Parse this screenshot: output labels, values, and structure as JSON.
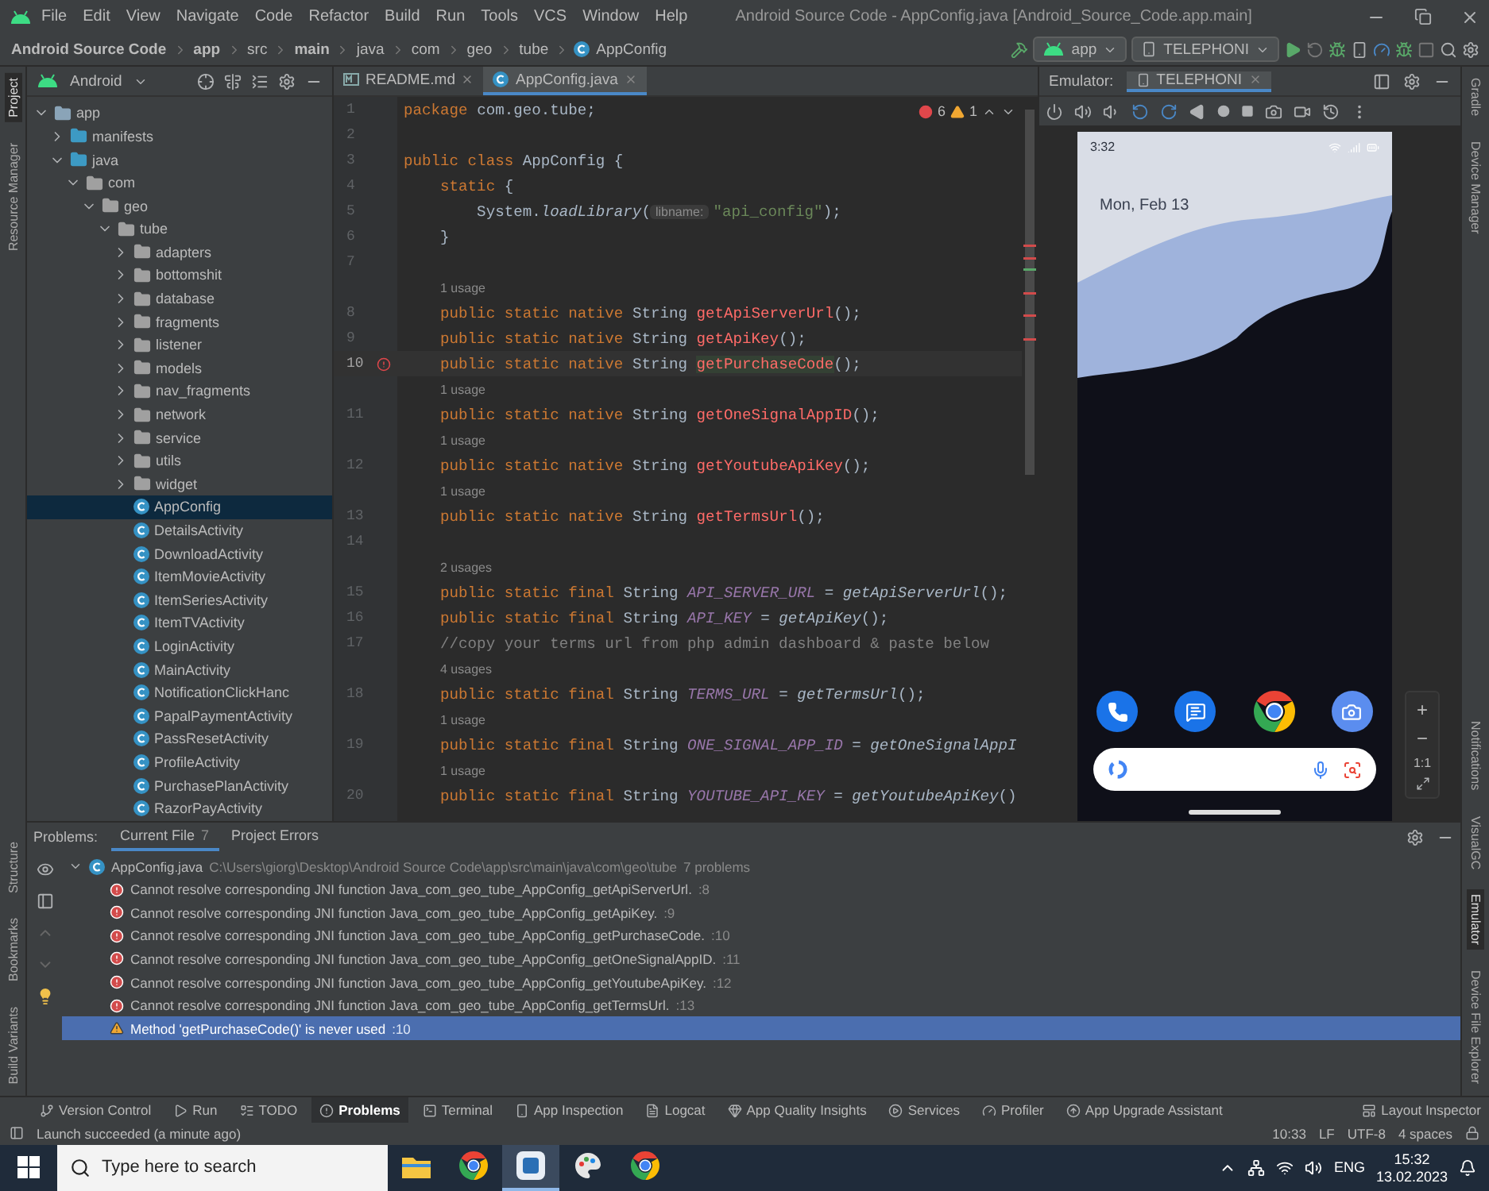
{
  "menu": [
    "File",
    "Edit",
    "View",
    "Navigate",
    "Code",
    "Refactor",
    "Build",
    "Run",
    "Tools",
    "VCS",
    "Window",
    "Help"
  ],
  "window_title": "Android Source Code - AppConfig.java [Android_Source_Code.app.main]",
  "breadcrumbs": [
    {
      "label": "Android Source Code",
      "bold": true
    },
    {
      "label": "app",
      "bold": true
    },
    {
      "label": "src",
      "bold": false
    },
    {
      "label": "main",
      "bold": true
    },
    {
      "label": "java",
      "bold": false
    },
    {
      "label": "com",
      "bold": false
    },
    {
      "label": "geo",
      "bold": false
    },
    {
      "label": "tube",
      "bold": false
    },
    {
      "label": "AppConfig",
      "bold": false
    }
  ],
  "run_config": "app",
  "device": "TELEPHONI",
  "left_strip": {
    "top": [
      {
        "label": "Project",
        "selected": true
      },
      {
        "label": "Resource Manager",
        "selected": false
      }
    ],
    "bottom": [
      {
        "label": "Structure",
        "selected": false
      },
      {
        "label": "Bookmarks",
        "selected": false
      },
      {
        "label": "Build Variants",
        "selected": false
      }
    ]
  },
  "right_strip": {
    "top": [
      {
        "label": "Gradle",
        "selected": false
      },
      {
        "label": "Device Manager",
        "selected": false
      }
    ],
    "bottom": [
      {
        "label": "Notifications",
        "selected": false
      },
      {
        "label": "VisualGC",
        "selected": false
      },
      {
        "label": "Emulator",
        "selected": true
      },
      {
        "label": "Device File Explorer",
        "selected": false
      }
    ]
  },
  "project": {
    "view": "Android",
    "tree": [
      {
        "label": "app",
        "kind": "module",
        "expanded": true,
        "selected": false,
        "children": [
          {
            "label": "manifests",
            "kind": "folder",
            "expanded": false,
            "selected": false
          },
          {
            "label": "java",
            "kind": "folder",
            "expanded": true,
            "selected": false,
            "children": [
              {
                "label": "com",
                "kind": "package",
                "expanded": true,
                "selected": false,
                "children": [
                  {
                    "label": "geo",
                    "kind": "package",
                    "expanded": true,
                    "selected": false,
                    "children": [
                      {
                        "label": "tube",
                        "kind": "package",
                        "expanded": true,
                        "selected": false,
                        "children": [
                          {
                            "label": "adapters",
                            "kind": "package",
                            "expanded": false,
                            "selected": false
                          },
                          {
                            "label": "bottomshit",
                            "kind": "package",
                            "expanded": false,
                            "selected": false
                          },
                          {
                            "label": "database",
                            "kind": "package",
                            "expanded": false,
                            "selected": false
                          },
                          {
                            "label": "fragments",
                            "kind": "package",
                            "expanded": false,
                            "selected": false
                          },
                          {
                            "label": "listener",
                            "kind": "package",
                            "expanded": false,
                            "selected": false
                          },
                          {
                            "label": "models",
                            "kind": "package",
                            "expanded": false,
                            "selected": false
                          },
                          {
                            "label": "nav_fragments",
                            "kind": "package",
                            "expanded": false,
                            "selected": false
                          },
                          {
                            "label": "network",
                            "kind": "package",
                            "expanded": false,
                            "selected": false
                          },
                          {
                            "label": "service",
                            "kind": "package",
                            "expanded": false,
                            "selected": false
                          },
                          {
                            "label": "utils",
                            "kind": "package",
                            "expanded": false,
                            "selected": false
                          },
                          {
                            "label": "widget",
                            "kind": "package",
                            "expanded": false,
                            "selected": false
                          },
                          {
                            "label": "AppConfig",
                            "kind": "class",
                            "selected": true
                          },
                          {
                            "label": "DetailsActivity",
                            "kind": "class",
                            "selected": false
                          },
                          {
                            "label": "DownloadActivity",
                            "kind": "class",
                            "selected": false
                          },
                          {
                            "label": "ItemMovieActivity",
                            "kind": "class",
                            "selected": false
                          },
                          {
                            "label": "ItemSeriesActivity",
                            "kind": "class",
                            "selected": false
                          },
                          {
                            "label": "ItemTVActivity",
                            "kind": "class",
                            "selected": false
                          },
                          {
                            "label": "LoginActivity",
                            "kind": "class",
                            "selected": false
                          },
                          {
                            "label": "MainActivity",
                            "kind": "class",
                            "selected": false
                          },
                          {
                            "label": "NotificationClickHanc",
                            "kind": "class",
                            "selected": false
                          },
                          {
                            "label": "PapalPaymentActivity",
                            "kind": "class",
                            "selected": false
                          },
                          {
                            "label": "PassResetActivity",
                            "kind": "class",
                            "selected": false
                          },
                          {
                            "label": "ProfileActivity",
                            "kind": "class",
                            "selected": false
                          },
                          {
                            "label": "PurchasePlanActivity",
                            "kind": "class",
                            "selected": false
                          },
                          {
                            "label": "RazorPayActivity",
                            "kind": "class",
                            "selected": false
                          }
                        ]
                      }
                    ]
                  }
                ]
              }
            ]
          }
        ]
      }
    ]
  },
  "editor": {
    "tabs": [
      {
        "label": "README.md",
        "kind": "markdown",
        "selected": false
      },
      {
        "label": "AppConfig.java",
        "kind": "class",
        "selected": true
      }
    ],
    "errors": "6",
    "warnings": "1",
    "lines": [
      {
        "number": "1",
        "current": false,
        "error_mark": false,
        "tokens": [
          {
            "kind": "kw",
            "text": "package "
          },
          {
            "kind": "plain",
            "text": "com.geo.tube;"
          }
        ]
      },
      {
        "number": "2",
        "current": false,
        "error_mark": false
      },
      {
        "number": "3",
        "current": false,
        "error_mark": false,
        "tokens": [
          {
            "kind": "kw",
            "text": "public class "
          },
          {
            "kind": "plain",
            "text": "AppConfig {"
          }
        ]
      },
      {
        "number": "4",
        "current": false,
        "error_mark": false,
        "tokens": [
          {
            "kind": "kw",
            "text": "    static "
          },
          {
            "kind": "plain",
            "text": "{"
          }
        ]
      },
      {
        "number": "5",
        "current": false,
        "error_mark": false,
        "tokens": [
          {
            "kind": "plain",
            "text": "        System."
          },
          {
            "kind": "call",
            "text": "loadLibrary"
          },
          {
            "kind": "plain",
            "text": "("
          },
          {
            "kind": "param",
            "text": "libname:"
          },
          {
            "kind": "str",
            "text": "\"api_config\""
          },
          {
            "kind": "plain",
            "text": ");"
          }
        ]
      },
      {
        "number": "6",
        "current": false,
        "error_mark": false,
        "tokens": [
          {
            "kind": "plain",
            "text": "    }"
          }
        ]
      },
      {
        "number": "7",
        "current": false,
        "error_mark": false
      },
      {
        "number": "8",
        "usage": "1 usage",
        "current": false,
        "error_mark": false,
        "tokens": [
          {
            "kind": "kw",
            "text": "    public static native "
          },
          {
            "kind": "plain",
            "text": "String "
          },
          {
            "kind": "native",
            "text": "getApiServerUrl"
          },
          {
            "kind": "plain",
            "text": "();"
          }
        ]
      },
      {
        "number": "9",
        "current": false,
        "error_mark": false,
        "tokens": [
          {
            "kind": "kw",
            "text": "    public static native "
          },
          {
            "kind": "plain",
            "text": "String "
          },
          {
            "kind": "native",
            "text": "getApiKey"
          },
          {
            "kind": "plain",
            "text": "();"
          }
        ]
      },
      {
        "number": "10",
        "current": true,
        "error_mark": true,
        "tokens": [
          {
            "kind": "kw",
            "text": "    public static native "
          },
          {
            "kind": "plain",
            "text": "String "
          },
          {
            "kind": "unused",
            "text": "getPurchaseCode"
          },
          {
            "kind": "plain",
            "text": "();"
          }
        ]
      },
      {
        "number": "11",
        "usage": "1 usage",
        "current": false,
        "error_mark": false,
        "tokens": [
          {
            "kind": "kw",
            "text": "    public static native "
          },
          {
            "kind": "plain",
            "text": "String "
          },
          {
            "kind": "native",
            "text": "getOneSignalAppID"
          },
          {
            "kind": "plain",
            "text": "();"
          }
        ]
      },
      {
        "number": "12",
        "usage": "1 usage",
        "current": false,
        "error_mark": false,
        "tokens": [
          {
            "kind": "kw",
            "text": "    public static native "
          },
          {
            "kind": "plain",
            "text": "String "
          },
          {
            "kind": "native",
            "text": "getYoutubeApiKey"
          },
          {
            "kind": "plain",
            "text": "();"
          }
        ]
      },
      {
        "number": "13",
        "usage": "1 usage",
        "current": false,
        "error_mark": false,
        "tokens": [
          {
            "kind": "kw",
            "text": "    public static native "
          },
          {
            "kind": "plain",
            "text": "String "
          },
          {
            "kind": "native",
            "text": "getTermsUrl"
          },
          {
            "kind": "plain",
            "text": "();"
          }
        ]
      },
      {
        "number": "14",
        "current": false,
        "error_mark": false
      },
      {
        "number": "15",
        "usage": "2 usages",
        "current": false,
        "error_mark": false,
        "tokens": [
          {
            "kind": "kw",
            "text": "    public static final "
          },
          {
            "kind": "plain",
            "text": "String "
          },
          {
            "kind": "const",
            "text": "API_SERVER_URL"
          },
          {
            "kind": "plain",
            "text": " = "
          },
          {
            "kind": "call",
            "text": "getApiServerUrl"
          },
          {
            "kind": "plain",
            "text": "();"
          }
        ]
      },
      {
        "number": "16",
        "current": false,
        "error_mark": false,
        "tokens": [
          {
            "kind": "kw",
            "text": "    public static final "
          },
          {
            "kind": "plain",
            "text": "String "
          },
          {
            "kind": "const",
            "text": "API_KEY"
          },
          {
            "kind": "plain",
            "text": " = "
          },
          {
            "kind": "call",
            "text": "getApiKey"
          },
          {
            "kind": "plain",
            "text": "();"
          }
        ]
      },
      {
        "number": "17",
        "current": false,
        "error_mark": false,
        "tokens": [
          {
            "kind": "comment",
            "text": "    //copy your terms url from php admin dashboard & paste below"
          }
        ]
      },
      {
        "number": "18",
        "usage": "4 usages",
        "current": false,
        "error_mark": false,
        "tokens": [
          {
            "kind": "kw",
            "text": "    public static final "
          },
          {
            "kind": "plain",
            "text": "String "
          },
          {
            "kind": "const",
            "text": "TERMS_URL"
          },
          {
            "kind": "plain",
            "text": " = "
          },
          {
            "kind": "call",
            "text": "getTermsUrl"
          },
          {
            "kind": "plain",
            "text": "();"
          }
        ]
      },
      {
        "number": "19",
        "usage": "1 usage",
        "current": false,
        "error_mark": false,
        "tokens": [
          {
            "kind": "kw",
            "text": "    public static final "
          },
          {
            "kind": "plain",
            "text": "String "
          },
          {
            "kind": "const",
            "text": "ONE_SIGNAL_APP_ID"
          },
          {
            "kind": "plain",
            "text": " = "
          },
          {
            "kind": "call",
            "text": "getOneSignalAppI"
          }
        ]
      },
      {
        "number": "20",
        "usage": "1 usage",
        "current": false,
        "error_mark": false,
        "tokens": [
          {
            "kind": "kw",
            "text": "    public static final "
          },
          {
            "kind": "plain",
            "text": "String "
          },
          {
            "kind": "const",
            "text": "YOUTUBE_API_KEY"
          },
          {
            "kind": "plain",
            "text": " = "
          },
          {
            "kind": "call",
            "text": "getYoutubeApiKey"
          },
          {
            "kind": "plain",
            "text": "()"
          }
        ]
      }
    ]
  },
  "emulator": {
    "label": "Emulator:",
    "tab": "TELEPHONI",
    "phone": {
      "time": "3:32",
      "date": "Mon, Feb 13"
    },
    "zoom": [
      "+",
      "−",
      "1:1"
    ]
  },
  "problems": {
    "label": "Problems:",
    "tabs": [
      {
        "label": "Current File",
        "count": "7",
        "selected": true
      },
      {
        "label": "Project Errors",
        "selected": false
      }
    ],
    "file": {
      "name": "AppConfig.java",
      "path": "C:\\Users\\giorg\\Desktop\\Android Source Code\\app\\src\\main\\java\\com\\geo\\tube",
      "count": "7 problems"
    },
    "items": [
      {
        "kind": "error",
        "text": "Cannot resolve corresponding JNI function Java_com_geo_tube_AppConfig_getApiServerUrl.",
        "line": ":8",
        "selected": false
      },
      {
        "kind": "error",
        "text": "Cannot resolve corresponding JNI function Java_com_geo_tube_AppConfig_getApiKey.",
        "line": ":9",
        "selected": false
      },
      {
        "kind": "error",
        "text": "Cannot resolve corresponding JNI function Java_com_geo_tube_AppConfig_getPurchaseCode.",
        "line": ":10",
        "selected": false
      },
      {
        "kind": "error",
        "text": "Cannot resolve corresponding JNI function Java_com_geo_tube_AppConfig_getOneSignalAppID.",
        "line": ":11",
        "selected": false
      },
      {
        "kind": "error",
        "text": "Cannot resolve corresponding JNI function Java_com_geo_tube_AppConfig_getYoutubeApiKey.",
        "line": ":12",
        "selected": false
      },
      {
        "kind": "error",
        "text": "Cannot resolve corresponding JNI function Java_com_geo_tube_AppConfig_getTermsUrl.",
        "line": ":13",
        "selected": false
      },
      {
        "kind": "warning",
        "text": "Method 'getPurchaseCode()' is never used",
        "line": ":10",
        "selected": true
      }
    ]
  },
  "tool_windows": {
    "left": [
      {
        "label": "Version Control",
        "kind": "vcs",
        "selected": false
      },
      {
        "label": "Run",
        "kind": "run",
        "selected": false
      },
      {
        "label": "TODO",
        "kind": "todo",
        "selected": false
      },
      {
        "label": "Problems",
        "kind": "problems",
        "selected": true
      },
      {
        "label": "Terminal",
        "kind": "terminal",
        "selected": false
      },
      {
        "label": "App Inspection",
        "kind": "inspection",
        "selected": false
      },
      {
        "label": "Logcat",
        "kind": "logcat",
        "selected": false
      },
      {
        "label": "App Quality Insights",
        "kind": "quality",
        "selected": false
      },
      {
        "label": "Services",
        "kind": "services",
        "selected": false
      },
      {
        "label": "Profiler",
        "kind": "profiler",
        "selected": false
      },
      {
        "label": "App Upgrade Assistant",
        "kind": "upgrade",
        "selected": false
      }
    ],
    "right": {
      "label": "Layout Inspector",
      "kind": "layout",
      "selected": false
    }
  },
  "status": {
    "message": "Launch succeeded (a minute ago)",
    "right": [
      "10:33",
      "LF",
      "UTF-8",
      "4 spaces"
    ]
  },
  "taskbar": {
    "search_placeholder": "Type here to search",
    "apps": [
      {
        "kind": "folder",
        "selected": false
      },
      {
        "kind": "browser",
        "selected": false
      },
      {
        "kind": "ide",
        "selected": true
      },
      {
        "kind": "paint",
        "selected": false
      },
      {
        "kind": "browser",
        "selected": false
      }
    ],
    "language": "ENG",
    "time": "15:32",
    "date": "13.02.2023"
  }
}
